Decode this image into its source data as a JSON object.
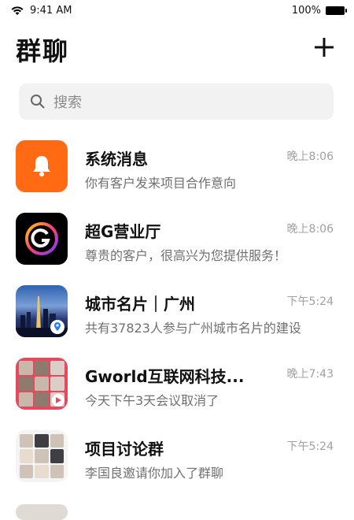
{
  "status_bar": {
    "time": "9:41 AM",
    "battery": "100%"
  },
  "header": {
    "title": "群聊"
  },
  "search": {
    "placeholder": "搜索"
  },
  "chats": [
    {
      "name": "系统消息",
      "message": "你有客户发来项目合作意向",
      "time": "晚上8:06"
    },
    {
      "name": "超G营业厅",
      "message": "尊贵的客户，很高兴为您提供服务！",
      "time": "晚上8:06"
    },
    {
      "name": "城市名片｜广州",
      "message": "共有37823人参与广州城市名片的建设",
      "time": "下午5:24"
    },
    {
      "name": "Gworld互联网科技...",
      "message": "今天下午3天会议取消了",
      "time": "晚上7:43"
    },
    {
      "name": "项目讨论群",
      "message": "李国良邀请你加入了群聊",
      "time": "下午5:24"
    }
  ],
  "colors": {
    "accent_orange": "#ff6a13",
    "search_bg": "#f2f2f2",
    "time_gray": "#a0a0a0"
  },
  "icons": [
    "wifi-icon",
    "battery-icon",
    "add-icon",
    "search-icon",
    "bell-icon",
    "g-logo-icon",
    "location-pin-icon",
    "play-icon"
  ]
}
